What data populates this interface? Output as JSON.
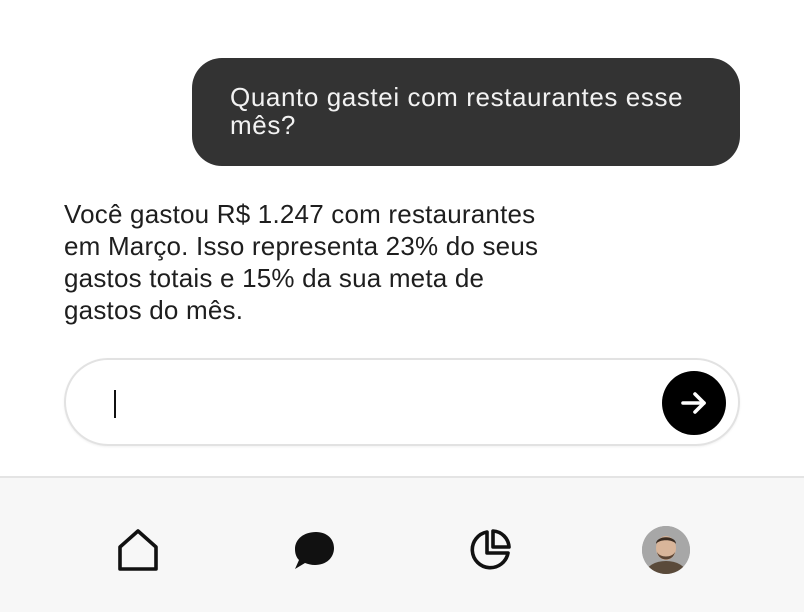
{
  "chat": {
    "user_message": "Quanto gastei com restaurantes esse mês?",
    "assistant_message": "Você gastou R$ 1.247 com restaurantes em Março. Isso representa 23% do seus gastos totais e 15% da sua meta de gastos do mês."
  },
  "composer": {
    "value": "",
    "send_icon": "arrow-right-icon"
  },
  "nav": {
    "items": [
      {
        "icon": "home-icon"
      },
      {
        "icon": "chat-bubble-icon"
      },
      {
        "icon": "pie-chart-icon"
      },
      {
        "icon": "avatar"
      }
    ]
  },
  "colors": {
    "user_bubble": "#333333",
    "send_button": "#000000",
    "nav_background": "#f7f7f7"
  }
}
